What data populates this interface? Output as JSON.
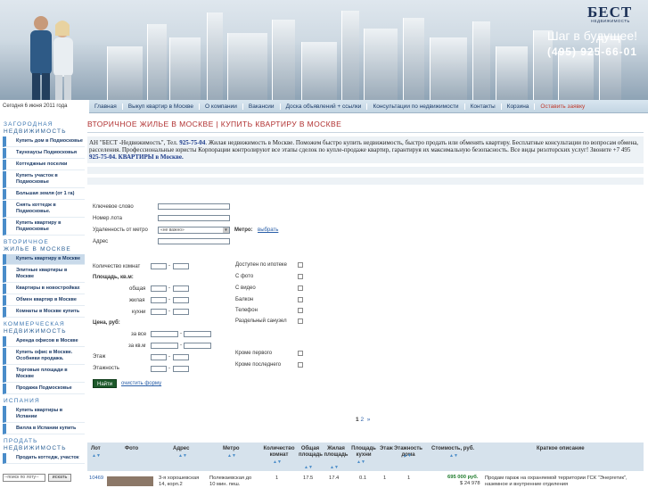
{
  "header": {
    "logo": "БЕСТ",
    "logo_sub": "НЕДВИЖИМОСТЬ",
    "slogan": "Шаг в будущее!",
    "phone": "(495) 925-66-01"
  },
  "date": "Сегодня 6 июня 2011 года",
  "nav": [
    "Главная",
    "Выкуп квартир в Москве",
    "О компании",
    "Вакансии",
    "Доска объявлений + ссылки",
    "Консультации по недвижимости",
    "Контакты",
    "Корзина",
    "Оставить заявку"
  ],
  "sidebar": {
    "groups": [
      {
        "title_l1": "ЗАГОРОДНАЯ",
        "title_l2": "НЕДВИЖИМОСТЬ",
        "items": [
          "Купить дом в Подмосковье",
          "Таунхаусы Подмосковья",
          "Коттеджные поселки",
          "Купить участок в Подмосковье",
          "Большая земля (от 1 га)",
          "Снять коттедж в Подмосковье.",
          "Купить квартиру в Подмосковье"
        ]
      },
      {
        "title_l1": "ВТОРИЧНОЕ",
        "title_l2": "ЖИЛЬЕ В МОСКВЕ",
        "items": [
          "Купить квартиру в Москве",
          "Элитные квартиры в Москве",
          "Квартиры в новостройках",
          "Обмен квартир в Москве",
          "Комнаты в Москве купить"
        ]
      },
      {
        "title_l1": "КОММЕРЧЕСКАЯ",
        "title_l2": "НЕДВИЖИМОСТЬ",
        "items": [
          "Аренда офисов в Москве",
          "Купить офис в Москве. Особняки продажа.",
          "Торговые площади в Москве",
          "Продажа Подмосковье"
        ]
      },
      {
        "title_l1": "ИСПАНИЯ",
        "title_l2": "",
        "items": [
          "Купить квартиры в Испании",
          "Вилла в Испании купить"
        ]
      },
      {
        "title_l1": "ПРОДАТЬ",
        "title_l2": "НЕДВИЖИМОСТЬ",
        "items": [
          "Продать коттедж, участок"
        ]
      }
    ],
    "search_placeholder": "--поиск по лоту--",
    "search_button": "искать"
  },
  "main": {
    "title": "ВТОРИЧНОЕ ЖИЛЬЕ В МОСКВЕ | КУПИТЬ КВАРТИРУ В МОСКВЕ",
    "intro_1": "АН \"БЕСТ -Недвижимость\", Тел.",
    "intro_phone": "925-75-04",
    "intro_2": ". Жилая недвижимость в Москве. Поможем быстро купить недвижимость, быстро продать или обменять квартиру. Бесплатные консультации по вопросам обмена, расселения.      Профессиональные юристы Корпорации контролируют все этапы сделок по купле-продаже квартир, гарантируя их максимальную безопасность. Все виды риэлторских услуг! Звоните +7 495",
    "intro_phone2": "925-75-04.",
    "intro_3": "КВАРТИРЫ в Москве."
  },
  "form": {
    "keyword": "Ключевое слово",
    "lot": "Номер лота",
    "metro_dist": "Удаленность от метро",
    "metro_dist_value": "«не важно»",
    "metro_label": "Метро:",
    "metro_link": "выбрать",
    "address": "Адрес",
    "rooms": "Количество комнат",
    "area": "Площадь, кв.м:",
    "total": "общая",
    "living": "жилая",
    "kitchen": "кухни",
    "price": "Цена, руб:",
    "price_all": "за все",
    "price_sqm": "за кв.м",
    "floor": "Этаж",
    "floors": "Этажность",
    "mortgage": "Доступен по ипотеке",
    "photo": "С фото",
    "video": "С видео",
    "balcony": "Балкон",
    "phone": "Телефон",
    "bath": "Раздельный санузел",
    "not_first": "Кроме первого",
    "not_last": "Кроме последнего",
    "find": "Найти",
    "clear": "очистить форму"
  },
  "pager": {
    "current": "1",
    "next": "2",
    "arrow": "»"
  },
  "table": {
    "headers": [
      "Лот",
      "Фото",
      "Адрес",
      "Метро",
      "Количество комнат",
      "Общая площадь",
      "Жилая площадь",
      "Площадь кухни",
      "Этаж",
      "Этажность дома",
      "Стоимость, руб.",
      "Краткое описание"
    ],
    "row": {
      "lot": "10469",
      "address": "3-я хорошевская 14, корп.2",
      "metro": "Полежаевская до 10 мин. пеш.",
      "rooms": "1",
      "total": "17.5",
      "living": "17.4",
      "kitchen": "0.1",
      "floor": "1",
      "floors": "1",
      "price": "695 000 руб.",
      "price2": "$ 24 978",
      "desc": "Продам гараж на охраняемой территории ГСК \"Энергетик\", наземное и внутренние отделения"
    }
  },
  "colors": {
    "accent": "#b03030",
    "nav_bg": "#c3d5e3",
    "link": "#2a5fa8",
    "price_green": "#1d7a2b"
  }
}
